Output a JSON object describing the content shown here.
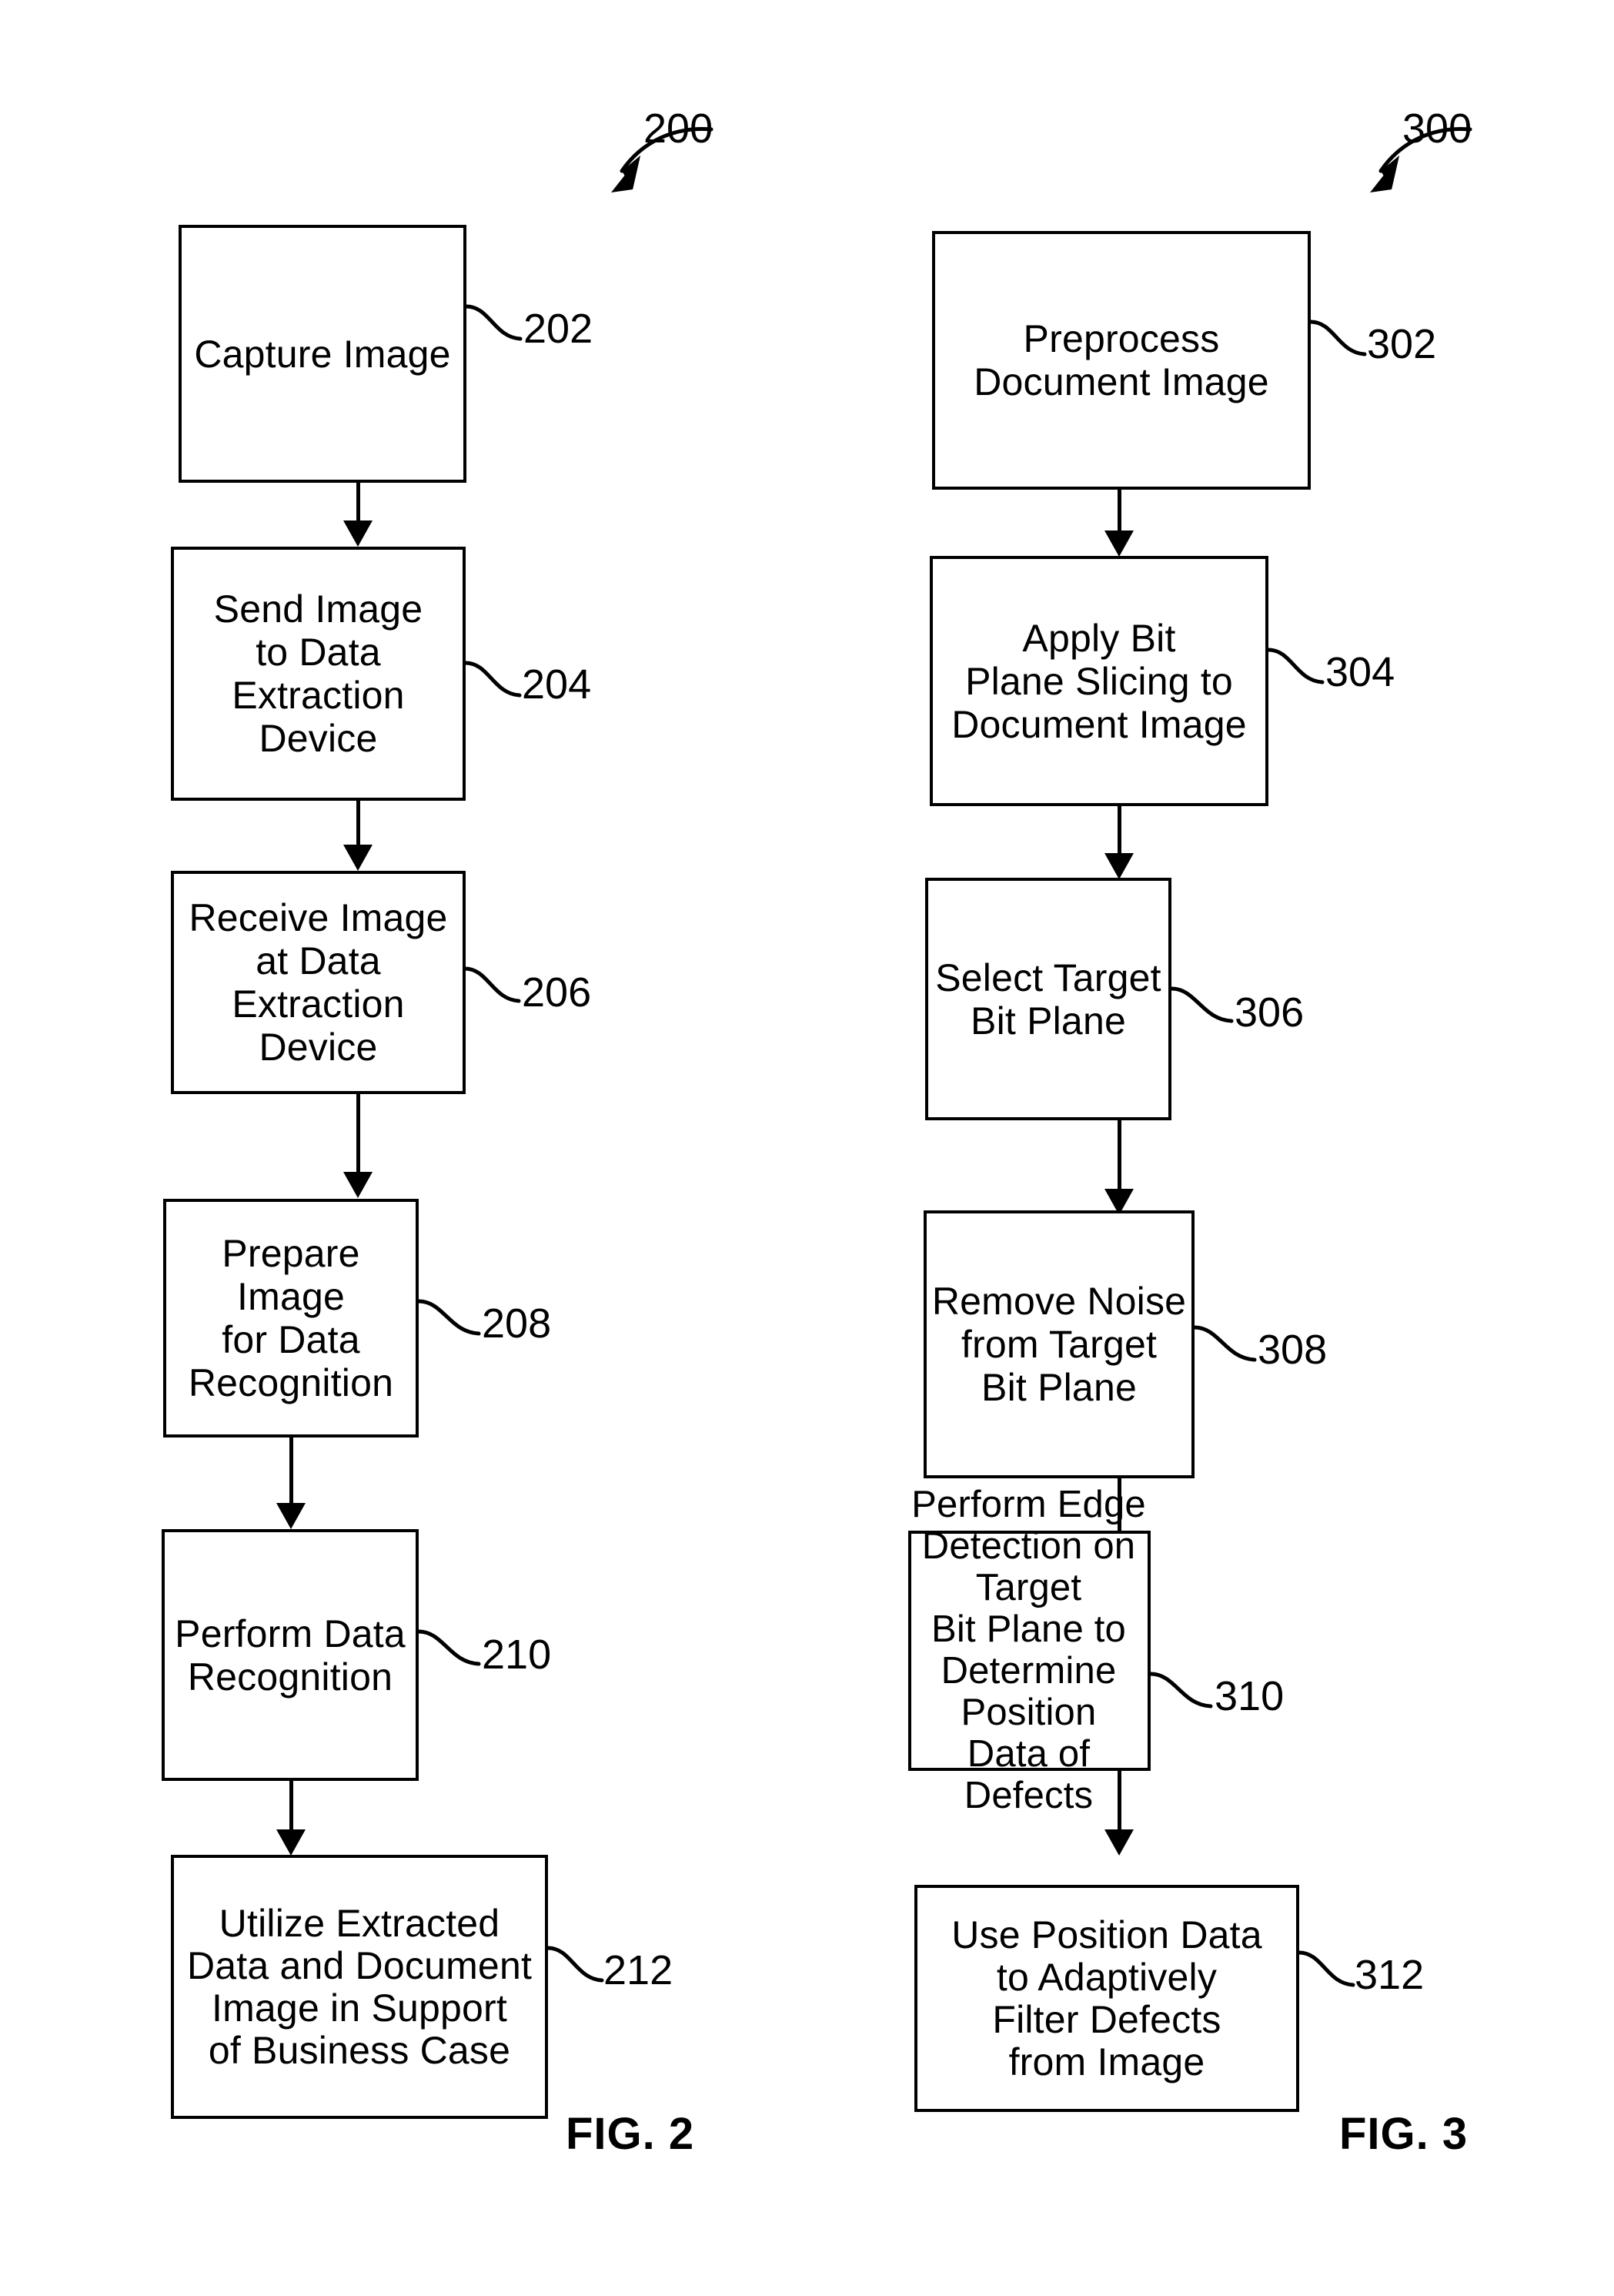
{
  "figures": [
    {
      "id": "fig2",
      "title": "FIG. 2",
      "ref": "200",
      "steps": [
        {
          "ref": "202",
          "text": "Capture Image"
        },
        {
          "ref": "204",
          "text": "Send Image\nto Data\nExtraction Device"
        },
        {
          "ref": "206",
          "text": "Receive Image\nat Data\nExtraction Device"
        },
        {
          "ref": "208",
          "text": "Prepare Image\nfor Data\nRecognition"
        },
        {
          "ref": "210",
          "text": "Perform Data\nRecognition"
        },
        {
          "ref": "212",
          "text": "Utilize Extracted\nData and Document\nImage in Support\nof Business Case"
        }
      ]
    },
    {
      "id": "fig3",
      "title": "FIG. 3",
      "ref": "300",
      "steps": [
        {
          "ref": "302",
          "text": "Preprocess\nDocument Image"
        },
        {
          "ref": "304",
          "text": "Apply Bit\nPlane Slicing to\nDocument Image"
        },
        {
          "ref": "306",
          "text": "Select Target\nBit Plane"
        },
        {
          "ref": "308",
          "text": "Remove Noise\nfrom Target\nBit Plane"
        },
        {
          "ref": "310",
          "text": "Perform Edge\nDetection on Target\nBit Plane to\nDetermine Position\nData of Defects"
        },
        {
          "ref": "312",
          "text": "Use Position Data\nto Adaptively\nFilter Defects\nfrom Image"
        }
      ]
    }
  ],
  "colors": {
    "ink": "#000000",
    "paper": "#ffffff"
  }
}
